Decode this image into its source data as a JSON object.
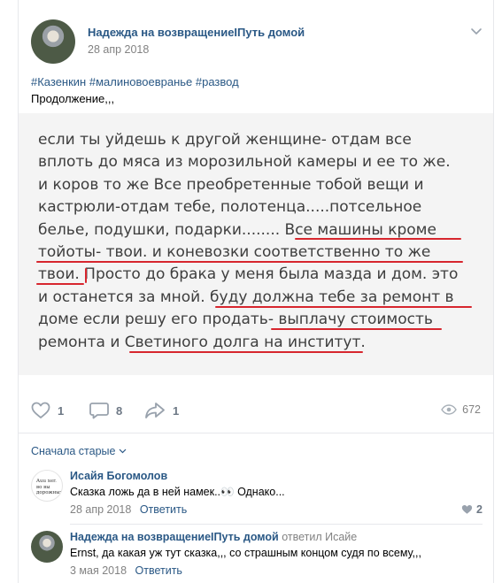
{
  "post": {
    "author": "Надежда на возвращениеIПуть домой",
    "date": "28 апр 2018",
    "hashtags": "#Казенкин #малиновоевранье #развод",
    "intro": "Продолжение,,,",
    "image_text_lines": [
      "если ты уйдешь к другой женщине- отдам все",
      "вплоть до мяса из морозильной камеры и ее то же.",
      "и коров то же  Все преобретенные тобой вещи и",
      "кастрюли-отдам тебе, полотенца.....потсельное",
      "белье,  подушки,  подарки........ Все  машины кроме",
      "тойоты- твои.  и коневозки соответственно то же",
      "твои. Просто до брака у меня была мазда и дом. это",
      "и останется за мной.  буду должна тебе за ремонт в",
      "доме если решу его продать- выплачу стоимость",
      "ремонта и Светиного долга на институт."
    ],
    "likes": "1",
    "comments": "8",
    "shares": "1",
    "views": "672"
  },
  "comments_section": {
    "sort_label": "Сначала старые",
    "comments": [
      {
        "author": "Исайя Богомолов",
        "replied_to": "",
        "avatar_text": "Auu xer. во вы дорожных.",
        "text": "Сказка ложь да в ней намек..👀 Однако...",
        "date": "28 апр 2018",
        "reply_label": "Ответить",
        "likes": "2"
      },
      {
        "author": "Надежда на возвращениеIПуть домой",
        "replied_to": "ответил Исайе",
        "text": "Ernst, да какая уж тут сказка,,, со страшным концом судя по всему,,,",
        "date": "3 мая 2018",
        "reply_label": "Ответить",
        "likes": ""
      }
    ]
  },
  "colors": {
    "link": "#2a5885",
    "muted": "#828282",
    "underline": "#d7262e",
    "icon": "#99a2ad"
  },
  "icons": {
    "post_menu": "chevron-down-icon",
    "like": "heart-icon",
    "comment": "comment-icon",
    "share": "share-icon",
    "views": "eye-icon",
    "sort": "chevron-down-icon"
  }
}
